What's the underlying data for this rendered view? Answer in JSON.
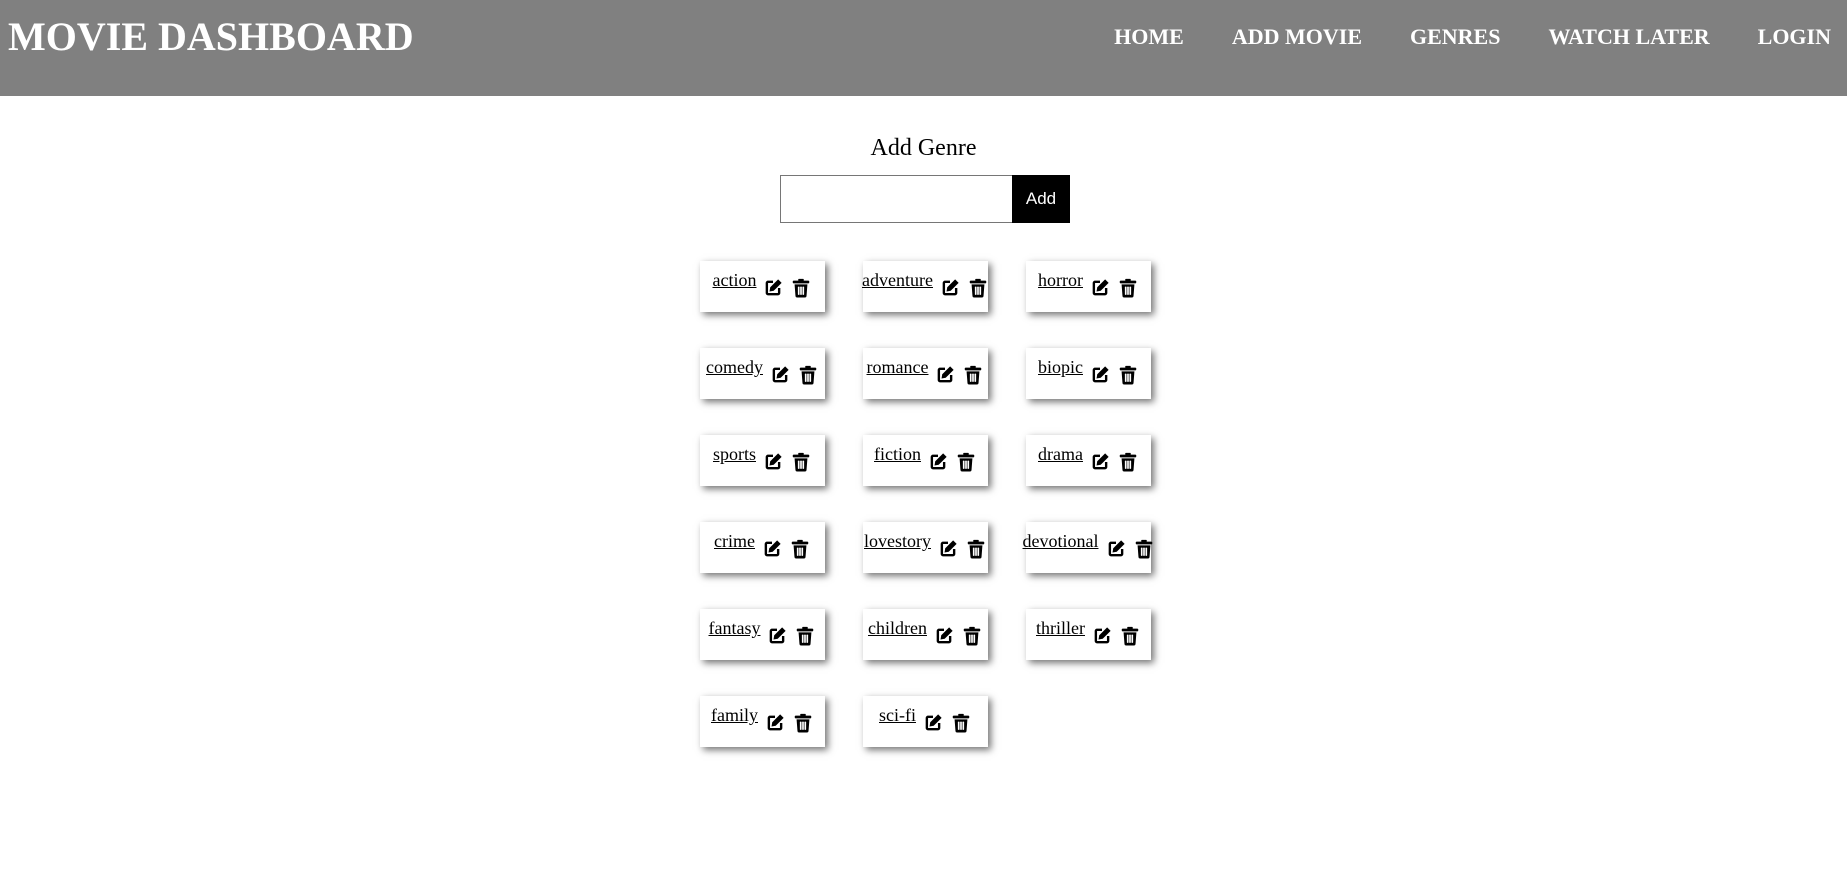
{
  "navbar": {
    "brand": "MOVIE DASHBOARD",
    "links": [
      {
        "label": "HOME"
      },
      {
        "label": "ADD MOVIE"
      },
      {
        "label": "GENRES"
      },
      {
        "label": "WATCH LATER"
      },
      {
        "label": "LOGIN"
      }
    ]
  },
  "add_genre": {
    "title": "Add Genre",
    "input_value": "",
    "input_placeholder": "",
    "button_label": "Add"
  },
  "genres": [
    {
      "name": "action"
    },
    {
      "name": "adventure"
    },
    {
      "name": "horror"
    },
    {
      "name": "comedy"
    },
    {
      "name": "romance"
    },
    {
      "name": "biopic"
    },
    {
      "name": "sports"
    },
    {
      "name": "fiction"
    },
    {
      "name": "drama"
    },
    {
      "name": "crime"
    },
    {
      "name": "lovestory"
    },
    {
      "name": "devotional"
    },
    {
      "name": "fantasy"
    },
    {
      "name": "children"
    },
    {
      "name": "thriller"
    },
    {
      "name": "family"
    },
    {
      "name": "sci-fi"
    }
  ],
  "icons": {
    "edit": "edit-icon",
    "delete": "trash-icon"
  },
  "colors": {
    "navbar_bg": "#808080",
    "nav_text": "#ffffff",
    "button_bg": "#000000"
  }
}
